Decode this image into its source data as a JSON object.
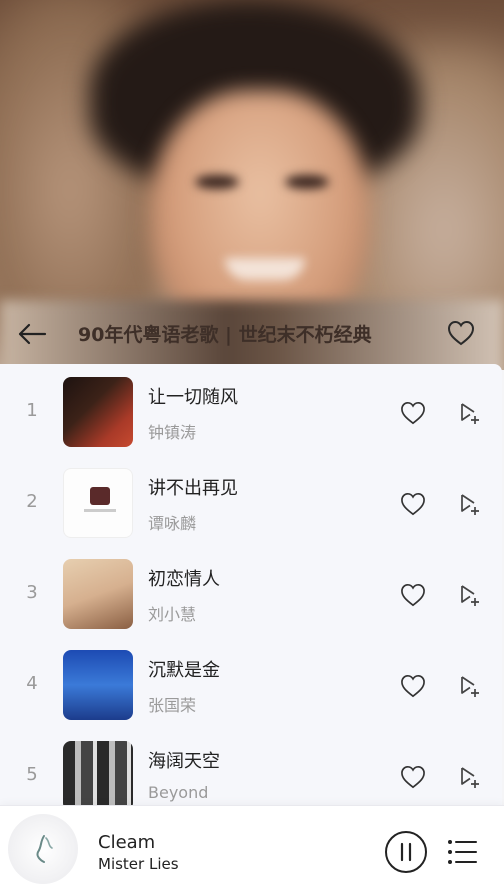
{
  "header": {
    "title": "90年代粤语老歌 | 世纪末不朽经典"
  },
  "songs": [
    {
      "index": "1",
      "name": "让一切随风",
      "artist": "钟镇涛",
      "cover": "c1"
    },
    {
      "index": "2",
      "name": "讲不出再见",
      "artist": "谭咏麟",
      "cover": "c2"
    },
    {
      "index": "3",
      "name": "初恋情人",
      "artist": "刘小慧",
      "cover": "c3"
    },
    {
      "index": "4",
      "name": "沉默是金",
      "artist": "张国荣",
      "cover": "c4"
    },
    {
      "index": "5",
      "name": "海阔天空",
      "artist": "Beyond",
      "cover": "c5"
    }
  ],
  "player": {
    "title": "Cleam",
    "artist": "Mister Lies"
  },
  "icons": {
    "back": "arrow-left-icon",
    "favorite": "heart-outline-icon",
    "like": "heart-outline-icon",
    "add": "add-to-playlist-icon",
    "pause": "pause-circle-icon",
    "queue": "list-icon"
  }
}
